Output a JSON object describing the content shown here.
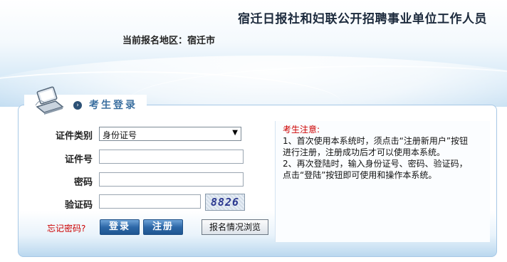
{
  "header": {
    "site_title": "宿迁日报社和妇联公开招聘事业单位工作人员",
    "region_label": "当前报名地区：宿迁市"
  },
  "login": {
    "title": "考生登录",
    "id_type_label": "证件类别",
    "id_type_value": "身份证号",
    "id_number_label": "证件号",
    "id_number_value": "",
    "password_label": "密码",
    "password_value": "",
    "captcha_label": "验证码",
    "captcha_value": "",
    "captcha_image_text": "8826",
    "forgot_password": "忘记密码?",
    "login_button": "登录",
    "register_button": "注册",
    "browse_button": "报名情况浏览"
  },
  "notice": {
    "title": "考生注意:",
    "lines": [
      "1、首次使用本系统时，须点击“注册新用户”按钮",
      "进行注册，注册成功后才可以使用本系统。",
      "2、再次登陆时，输入身份证号、密码、验证码，",
      "点击“登陆”按钮即可使用和操作本系统。"
    ]
  }
}
